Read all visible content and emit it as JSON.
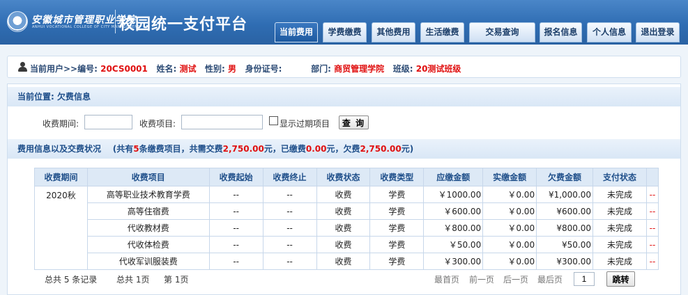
{
  "header": {
    "school_name": "安徽城市管理职业学院",
    "school_name_en": "ANHUI VOCATIONAL COLLEGE OF CITY MANAGEMENT",
    "app_title": "校园统一支付平台",
    "nav": [
      "当前费用",
      "学费缴费",
      "其他费用",
      "生活缴费",
      "交易查询",
      "报名信息",
      "个人信息",
      "退出登录"
    ],
    "active_nav": "当前费用"
  },
  "user": {
    "prefix": "当前用户>>编号:",
    "id": "20CS0001",
    "name_label": "姓名:",
    "name": "测试",
    "gender_label": "性别:",
    "gender": "男",
    "idcard_label": "身份证号:",
    "idcard": "",
    "dept_label": "部门:",
    "dept": "商贸管理学院",
    "class_label": "班级:",
    "class": "20测试班级"
  },
  "location": {
    "text": "当前位置: 欠费信息"
  },
  "filter": {
    "period_label": "收费期间:",
    "period_value": "",
    "item_label": "收费项目:",
    "item_value": "",
    "show_expired_label": "显示过期项目",
    "query_label": "查 询"
  },
  "summary": {
    "title": "费用信息以及交费状况",
    "p1": "(共有",
    "count": "5",
    "p2": "条缴费项目，共需交费",
    "total_due": "2,750.00",
    "p3": "元，已缴费",
    "paid": "0.00",
    "p4": "元，欠费",
    "owed": "2,750.00",
    "p5": "元)"
  },
  "table": {
    "headers": [
      "收费期间",
      "收费项目",
      "收费起始",
      "收费终止",
      "收费状态",
      "收费类型",
      "应缴金额",
      "实缴金额",
      "欠费金额",
      "支付状态",
      ""
    ],
    "rows": [
      [
        "2020秋",
        "高等职业技术教育学费",
        "--",
        "--",
        "收费",
        "学费",
        "￥1000.00",
        "￥0.00",
        "¥1,000.00",
        "未完成",
        "--"
      ],
      [
        "",
        "高等住宿费",
        "--",
        "--",
        "收费",
        "学费",
        "￥600.00",
        "￥0.00",
        "¥600.00",
        "未完成",
        "--"
      ],
      [
        "",
        "代收教材费",
        "--",
        "--",
        "收费",
        "学费",
        "￥800.00",
        "￥0.00",
        "¥800.00",
        "未完成",
        "--"
      ],
      [
        "",
        "代收体检费",
        "--",
        "--",
        "收费",
        "学费",
        "￥50.00",
        "￥0.00",
        "¥50.00",
        "未完成",
        "--"
      ],
      [
        "",
        "代收军训服装费",
        "--",
        "--",
        "收费",
        "学费",
        "￥300.00",
        "￥0.00",
        "¥300.00",
        "未完成",
        "--"
      ]
    ]
  },
  "pager": {
    "total_records": "总共  5 条记录",
    "total_pages": "总共  1页",
    "current_page": "第 1页",
    "first": "最首页",
    "prev": "前一页",
    "next": "后一页",
    "last": "最后页",
    "page_input": "1",
    "jump": "跳转"
  }
}
